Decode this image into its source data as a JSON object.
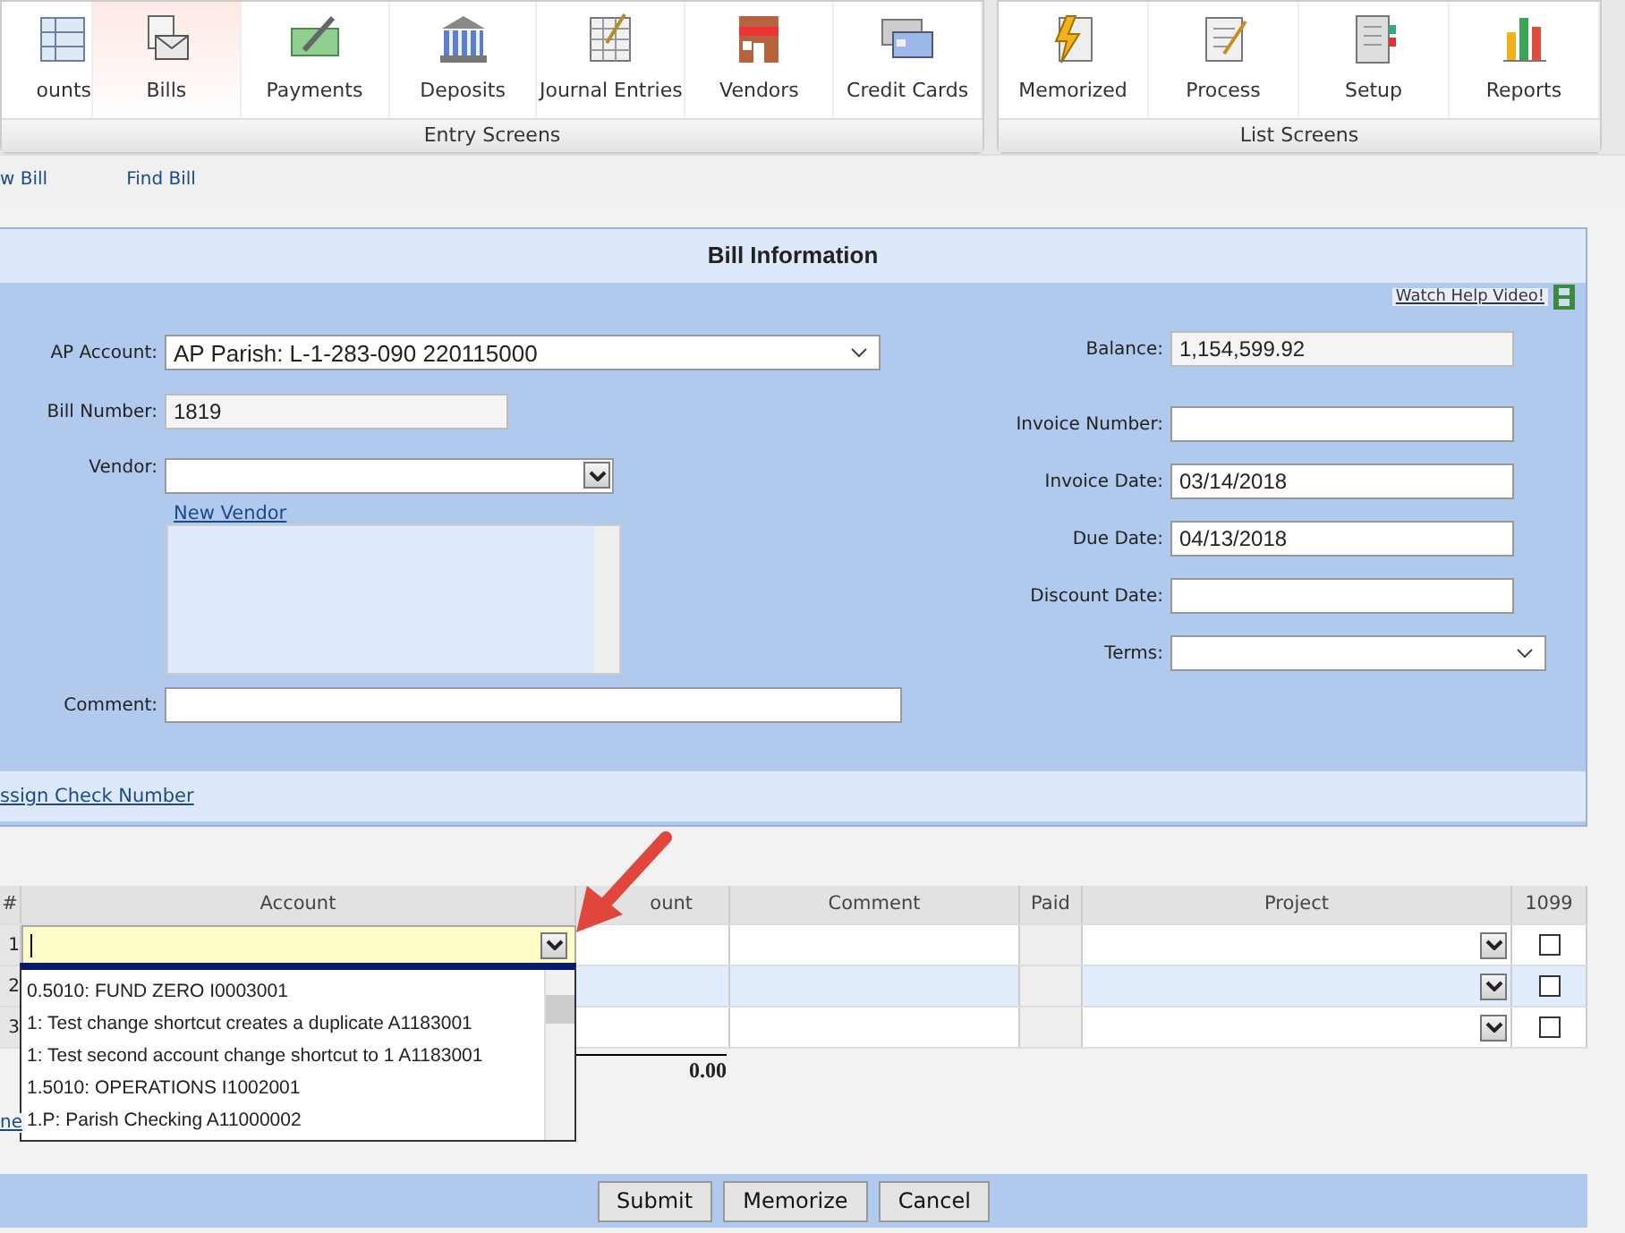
{
  "toolbar": {
    "groups": [
      {
        "label": "Entry Screens",
        "items": [
          {
            "label": "ounts",
            "selected": false
          },
          {
            "label": "Bills",
            "selected": true
          },
          {
            "label": "Payments",
            "selected": false
          },
          {
            "label": "Deposits",
            "selected": false
          },
          {
            "label": "Journal Entries",
            "selected": false
          },
          {
            "label": "Vendors",
            "selected": false
          },
          {
            "label": "Credit Cards",
            "selected": false
          }
        ]
      },
      {
        "label": "List Screens",
        "items": [
          {
            "label": "Memorized",
            "selected": false
          },
          {
            "label": "Process",
            "selected": false
          },
          {
            "label": "Setup",
            "selected": false
          },
          {
            "label": "Reports",
            "selected": false
          }
        ]
      }
    ]
  },
  "subnav": [
    "w Bill",
    "Find Bill"
  ],
  "form": {
    "title": "Bill Information",
    "help_link": "Watch Help Video!",
    "ap_account": {
      "label": "AP Account:",
      "value": "AP Parish: L-1-283-090 220115000"
    },
    "bill_number": {
      "label": "Bill Number:",
      "value": "1819"
    },
    "vendor": {
      "label": "Vendor:"
    },
    "new_vendor_link": "New Vendor",
    "comment": {
      "label": "Comment:"
    },
    "balance": {
      "label": "Balance:",
      "value": "1,154,599.92"
    },
    "invoice_number": {
      "label": "Invoice Number:"
    },
    "invoice_date": {
      "label": "Invoice Date:",
      "value": "03/14/2018"
    },
    "due_date": {
      "label": "Due Date:",
      "value": "04/13/2018"
    },
    "discount_date": {
      "label": "Discount Date:"
    },
    "terms": {
      "label": "Terms:"
    },
    "assign_check_link": "ssign Check Number"
  },
  "table": {
    "columns": [
      "#",
      "Account",
      "ount",
      "Comment",
      "Paid",
      "Project",
      "1099"
    ],
    "rows": [
      {
        "number": "1",
        "selected": false,
        "checked": false
      },
      {
        "number": "2",
        "selected": true,
        "checked": false
      },
      {
        "number": "3",
        "selected": false,
        "checked": false
      }
    ],
    "total": "0.00",
    "account_dropdown": {
      "items": [
        "0.5010: FUND ZERO I0003001",
        "1: Test change shortcut creates a duplicate A1183001",
        "1: Test second account change shortcut to 1 A1183001",
        "1.5010: OPERATIONS I1002001",
        "1.P: Parish Checking A11000002"
      ]
    }
  },
  "side_link": "ne",
  "buttons": [
    "Submit",
    "Memorize",
    "Cancel"
  ]
}
